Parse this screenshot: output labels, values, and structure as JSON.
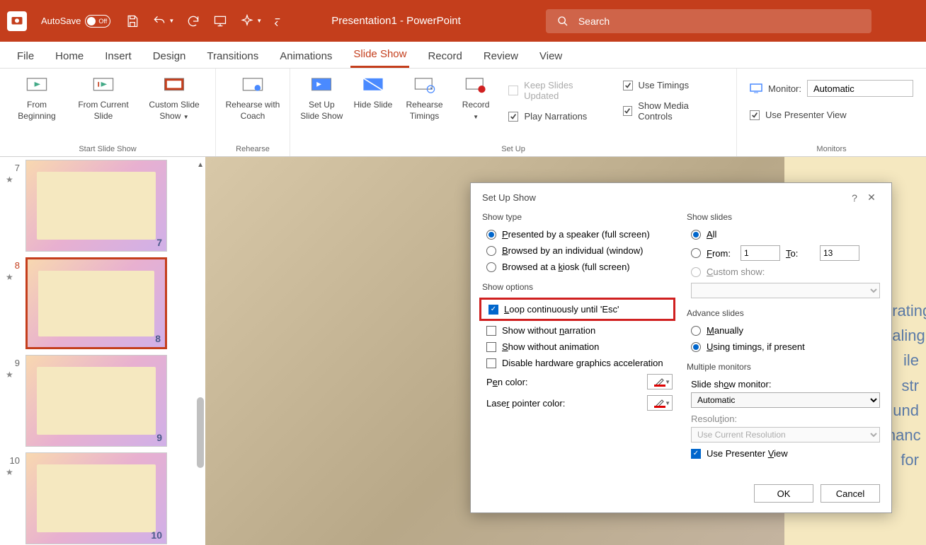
{
  "titlebar": {
    "autosave_label": "AutoSave",
    "autosave_state": "Off",
    "doc_title": "Presentation1  -  PowerPoint",
    "search_placeholder": "Search"
  },
  "tabs": [
    "File",
    "Home",
    "Insert",
    "Design",
    "Transitions",
    "Animations",
    "Slide Show",
    "Record",
    "Review",
    "View"
  ],
  "active_tab": "Slide Show",
  "ribbon": {
    "group1": {
      "label": "Start Slide Show",
      "btn1": "From Beginning",
      "btn2": "From Current Slide",
      "btn3": "Custom Slide Show"
    },
    "group2": {
      "label": "Rehearse",
      "btn1": "Rehearse with Coach"
    },
    "group3": {
      "label": "Set Up",
      "btn1": "Set Up Slide Show",
      "btn2": "Hide Slide",
      "btn3": "Rehearse Timings",
      "btn4": "Record",
      "chk1": "Keep Slides Updated",
      "chk2": "Play Narrations",
      "chk3": "Use Timings",
      "chk4": "Show Media Controls"
    },
    "group4": {
      "label": "Monitors",
      "monitor_label": "Monitor:",
      "monitor_value": "Automatic",
      "chk1": "Use Presenter View"
    }
  },
  "thumbs": [
    {
      "num": "7",
      "sel": false
    },
    {
      "num": "8",
      "sel": true
    },
    {
      "num": "9",
      "sel": false
    },
    {
      "num": "10",
      "sel": false
    }
  ],
  "dialog": {
    "title": "Set Up Show",
    "show_type": {
      "title": "Show type",
      "opt1": "Presented by a speaker (full screen)",
      "opt2": "Browsed by an individual (window)",
      "opt3": "Browsed at a kiosk (full screen)"
    },
    "show_options": {
      "title": "Show options",
      "opt1": "Loop continuously until 'Esc'",
      "opt2": "Show without narration",
      "opt3": "Show without animation",
      "opt4": "Disable hardware graphics acceleration",
      "pen": "Pen color:",
      "laser": "Laser pointer color:"
    },
    "show_slides": {
      "title": "Show slides",
      "all": "All",
      "from": "From:",
      "from_val": "1",
      "to": "To:",
      "to_val": "13",
      "custom": "Custom show:"
    },
    "advance": {
      "title": "Advance slides",
      "manual": "Manually",
      "timing": "Using timings, if present"
    },
    "monitors": {
      "title": "Multiple monitors",
      "monitor_label": "Slide show monitor:",
      "monitor_val": "Automatic",
      "res_label": "Resolution:",
      "res_val": "Use Current Resolution",
      "presenter": "Use Presenter View"
    },
    "ok": "OK",
    "cancel": "Cancel"
  },
  "colors": {
    "pen_strip": "#d00000",
    "laser_strip": "#d00000"
  },
  "slide_bg_text": "erating\nnaling\nile str\nund\ninanc\nfor"
}
